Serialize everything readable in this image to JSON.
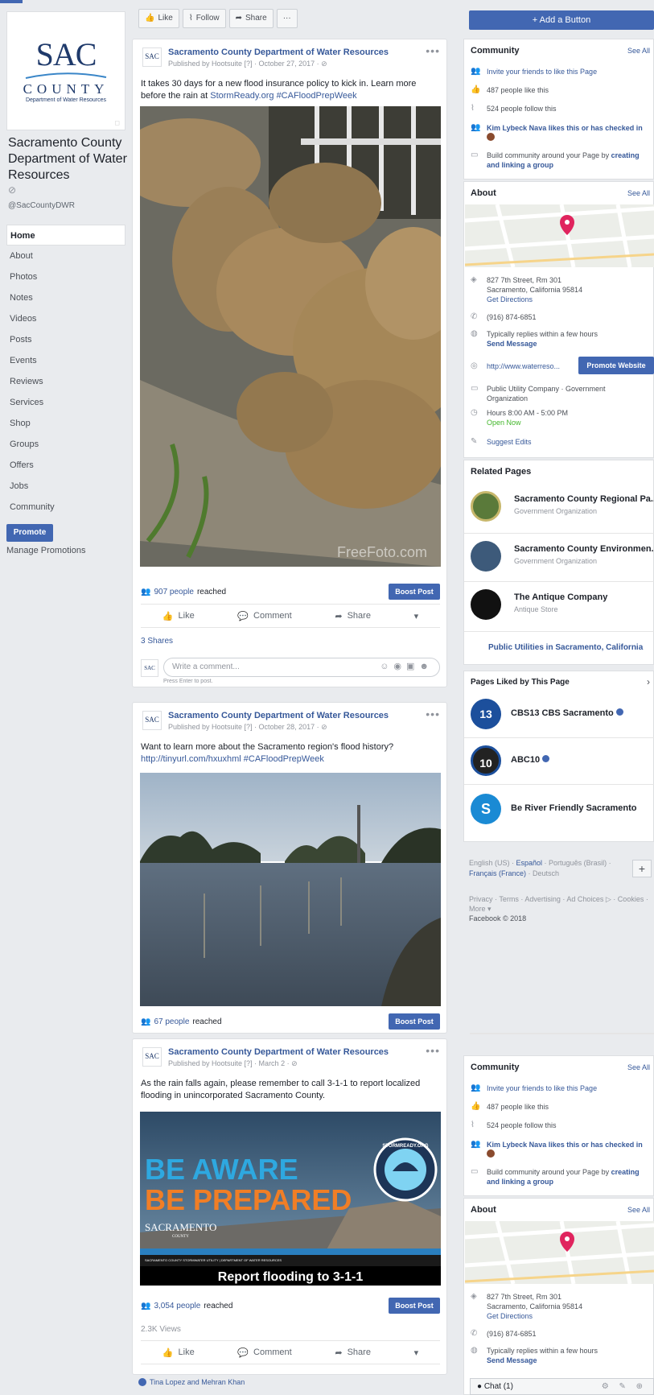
{
  "sidebar": {
    "page_name": "Sacramento County Department of Water Resources",
    "handle": "@SacCountyDWR",
    "logo_sac": "SAC",
    "logo_county": "COUNTY",
    "logo_dept": "Department of Water Resources",
    "nav": [
      "Home",
      "About",
      "Photos",
      "Notes",
      "Videos",
      "Posts",
      "Events",
      "Reviews",
      "Services",
      "Shop",
      "Groups",
      "Offers",
      "Jobs",
      "Community"
    ],
    "promote_label": "Promote",
    "manage_label": "Manage Promotions"
  },
  "actionbar": {
    "like": "Like",
    "follow": "Follow",
    "share": "Share",
    "more": "···"
  },
  "add_button": "+ Add a Button",
  "posts": [
    {
      "author": "Sacramento County Department of Water Resources",
      "meta": "Published by Hootsuite [?] · October 27, 2017 · ⊘",
      "text_before": "It takes 30 days for a new flood insurance policy to kick in. Learn more before the rain at ",
      "link": "StormReady.org #CAFloodPrepWeek",
      "watermark": "FreeFoto.com",
      "reach_count": "907 people",
      "reach_suffix": "reached",
      "boost": "Boost Post",
      "like": "Like",
      "comment": "Comment",
      "share": "Share",
      "shares": "3 Shares",
      "comment_placeholder": "Write a comment...",
      "enter_hint": "Press Enter to post."
    },
    {
      "author": "Sacramento County Department of Water Resources",
      "meta": "Published by Hootsuite [?] · October 28, 2017 · ⊘",
      "text_before": "Want to learn more about the Sacramento region's flood history? ",
      "link": "http://tinyurl.com/hxuxhml #CAFloodPrepWeek",
      "reach_count": "67 people",
      "reach_suffix": "reached",
      "boost": "Boost Post"
    },
    {
      "author": "Sacramento County Department of Water Resources",
      "meta": "Published by Hootsuite [?] · March 2 · ⊘",
      "text_before": "As the rain falls again, please remember to call 3-1-1 to report localized flooding in unincorporated Sacramento County.",
      "banner_line1": "BE AWARE",
      "banner_line2": "BE PREPARED",
      "banner_brand": "SACRAMENTO",
      "banner_brand_sub": "COUNTY",
      "banner_strip": "SACRAMENTO COUNTY STORMWATER UTILITY | DEPARTMENT OF WATER RESOURCES",
      "banner_report": "Report flooding to 3-1-1",
      "badge": "STORMREADY.ORG",
      "reach_count": "3,054 people",
      "reach_suffix": "reached",
      "boost": "Boost Post",
      "views": "2.3K Views",
      "like": "Like",
      "comment": "Comment",
      "share": "Share",
      "friends_like": "Tina Lopez and Mehran Khan"
    }
  ],
  "community": {
    "title": "Community",
    "see_all": "See All",
    "invite": "Invite your friends to like this Page",
    "likes": "487 people like this",
    "follows": "524 people follow this",
    "checkin": "Kim Lybeck Nava likes this or has checked in",
    "build": "Build community around your Page by ",
    "build_link": "creating and linking a group"
  },
  "about": {
    "title": "About",
    "see_all": "See All",
    "address1": "827 7th Street, Rm 301",
    "address2": "Sacramento, California 95814",
    "directions": "Get Directions",
    "phone": "(916) 874-6851",
    "replies": "Typically replies within a few hours",
    "send": "Send Message",
    "website": "http://www.waterreso...",
    "promote_website": "Promote Website",
    "category1": "Public Utility Company · Government",
    "category2": "Organization",
    "hours": "Hours 8:00 AM - 5:00 PM",
    "open": "Open Now",
    "suggest": "Suggest Edits"
  },
  "related": {
    "title": "Related Pages",
    "items": [
      {
        "name": "Sacramento County Regional Pa...",
        "cat": "Government Organization"
      },
      {
        "name": "Sacramento County Environmen...",
        "cat": "Government Organization"
      },
      {
        "name": "The Antique Company",
        "cat": "Antique Store"
      }
    ],
    "footer_link": "Public Utilities in Sacramento, California"
  },
  "liked": {
    "title": "Pages Liked by This Page",
    "close": "›",
    "items": [
      {
        "name": "CBS13 CBS Sacramento",
        "logo": "13"
      },
      {
        "name": "ABC10",
        "logo": "10"
      },
      {
        "name": "Be River Friendly Sacramento",
        "logo": "S"
      }
    ]
  },
  "languages": {
    "current": "English (US) · ",
    "es": "Español",
    "pt": " · Português (Brasil) · ",
    "fr": "Français (France)",
    "de": " · Deutsch",
    "plus": "+"
  },
  "footer": {
    "links": "Privacy · Terms · Advertising · Ad Choices ▷ · Cookies · More ▾",
    "copyright": "Facebook © 2018"
  },
  "chat": {
    "label": "● Chat (1)",
    "icons": "⚙ ✎ ⊕"
  },
  "colors": {
    "brand": "#4267b2",
    "link": "#365899",
    "page_bg": "#e9ebee"
  }
}
